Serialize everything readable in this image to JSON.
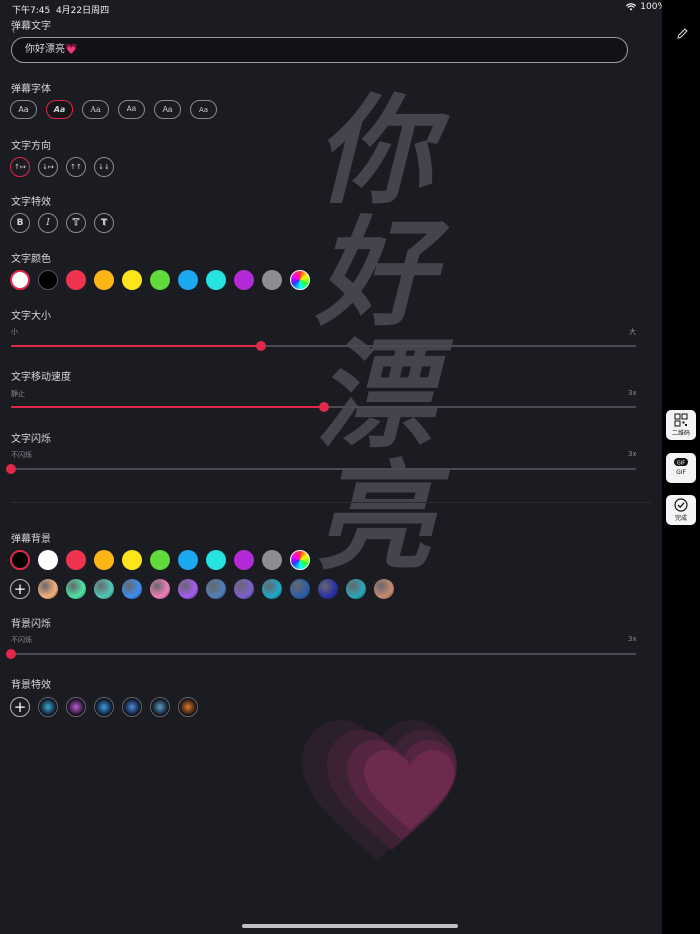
{
  "status": {
    "time": "下午7:45",
    "date": "4月22日周四",
    "battery": "100%"
  },
  "text_section": {
    "label": "弹幕文字",
    "value": "你好漂亮💗"
  },
  "font_section": {
    "label": "弹幕字体",
    "options": [
      "Aa",
      "Aa",
      "Aa",
      "Aa",
      "Aa",
      "Aa"
    ],
    "selected_index": 1
  },
  "direction_section": {
    "label": "文字方向",
    "options": [
      "↑↦",
      "↓↦",
      "↑↑",
      "↓↓"
    ],
    "selected_index": 0
  },
  "effect_section": {
    "label": "文字特效",
    "options": [
      "B",
      "I",
      "T",
      "T"
    ]
  },
  "color_section": {
    "label": "文字颜色",
    "colors": [
      "#ffffff",
      "#000000",
      "#f0334f",
      "#fbb616",
      "#fce51a",
      "#5fd93c",
      "#1aa8f0",
      "#28e2e1",
      "#b32ad6",
      "#8d8d94"
    ],
    "selected": "#ffffff"
  },
  "size_section": {
    "label": "文字大小",
    "min_label": "小",
    "max_label": "大",
    "value": 0.4
  },
  "speed_section": {
    "label": "文字移动速度",
    "min_label": "静止",
    "max_label": "3x",
    "value": 0.5
  },
  "blink_section": {
    "label": "文字闪烁",
    "min_label": "不闪烁",
    "max_label": "3x",
    "value": 0.0
  },
  "bg_section": {
    "label": "弹幕背景",
    "colors": [
      "#000000",
      "#ffffff",
      "#f0334f",
      "#fbb616",
      "#fce51a",
      "#5fd93c",
      "#1aa8f0",
      "#28e2e1",
      "#b32ad6",
      "#8d8d94"
    ],
    "selected": "#000000",
    "gradients": [
      "#f4b07a",
      "#4ee6a5",
      "#52c9b7",
      "#3a8ef0",
      "#f07fb9",
      "#a45bf0",
      "#4f7fb8",
      "#7f5fd0",
      "#1fa9c9",
      "#2a5ea8",
      "#2a2fa8",
      "#2aa8b8",
      "#c88a72"
    ]
  },
  "bg_blink_section": {
    "label": "背景闪烁",
    "min_label": "不闪烁",
    "max_label": "3x",
    "value": 0.0
  },
  "bg_effect_section": {
    "label": "背景特效",
    "effects": [
      "#3fa9d9",
      "#c25ad8",
      "#3aa0e6",
      "#4c8be0",
      "#5a9cc8",
      "#e07a2a"
    ]
  },
  "preview": {
    "text": "你好漂亮"
  },
  "side": {
    "qr_label": "二维码",
    "gif_label": "GIF",
    "done_label": "完成"
  }
}
